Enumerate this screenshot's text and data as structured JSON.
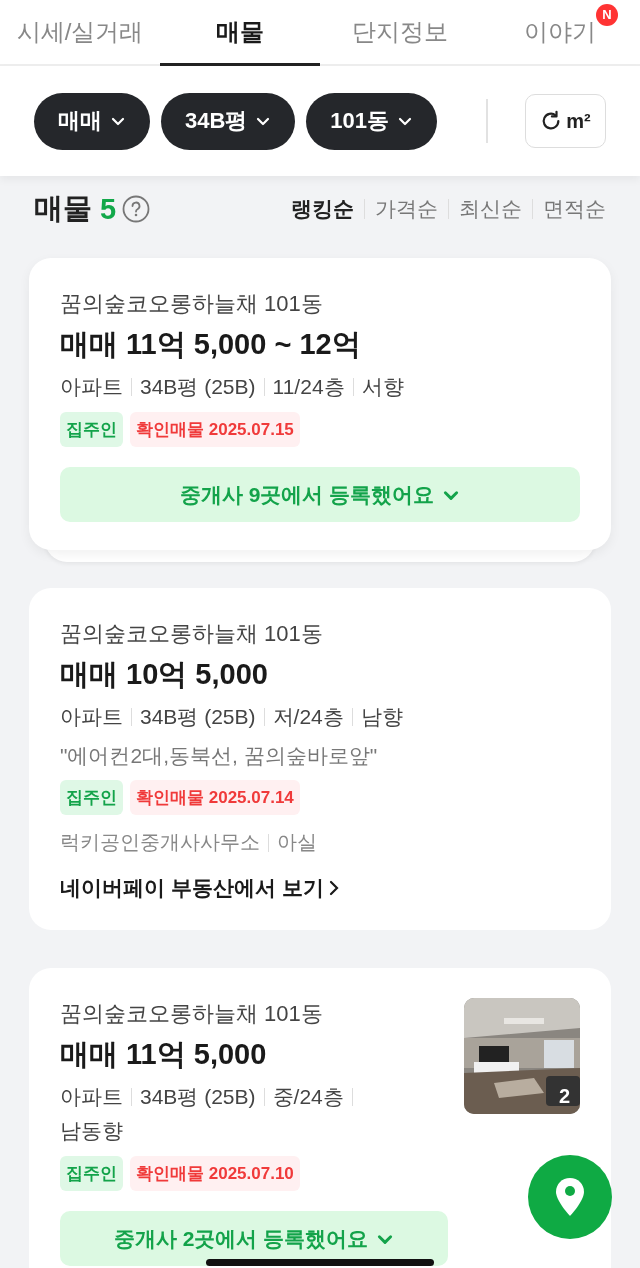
{
  "tabs": [
    {
      "label": "시세/실거래",
      "selected": false
    },
    {
      "label": "매물",
      "selected": true
    },
    {
      "label": "단지정보",
      "selected": false
    },
    {
      "label": "이야기",
      "selected": false,
      "badge": "N"
    }
  ],
  "filters": [
    {
      "label": "매매"
    },
    {
      "label": "34B평"
    },
    {
      "label": "101동"
    }
  ],
  "unit_button": {
    "label": "m²"
  },
  "listing_header": {
    "title": "매물",
    "count": "5"
  },
  "sort_options": [
    {
      "label": "랭킹순",
      "selected": true
    },
    {
      "label": "가격순",
      "selected": false
    },
    {
      "label": "최신순",
      "selected": false
    },
    {
      "label": "면적순",
      "selected": false
    }
  ],
  "listings": [
    {
      "name": "꿈의숲코오롱하늘채 101동",
      "price": "매매 11억 5,000 ~ 12억",
      "meta": [
        "아파트",
        "34B평 (25B)",
        "11/24층",
        "서향"
      ],
      "tags": [
        {
          "label": "집주인",
          "kind": "owner"
        },
        {
          "label": "확인매물 2025.07.15",
          "kind": "verified"
        }
      ],
      "brokers": "중개사 **9**곳에서 등록했어요",
      "stacked": true
    },
    {
      "name": "꿈의숲코오롱하늘채 101동",
      "price": "매매 10억 5,000",
      "meta": [
        "아파트",
        "34B평 (25B)",
        "저/24층",
        "남향"
      ],
      "description": "\"에어컨2대,동북선, 꿈의숲바로앞\"",
      "tags": [
        {
          "label": "집주인",
          "kind": "owner"
        },
        {
          "label": "확인매물 2025.07.14",
          "kind": "verified"
        }
      ],
      "agent": [
        "럭키공인중개사사무소",
        "아실"
      ],
      "link": "네이버페이 부동산에서 보기"
    },
    {
      "name": "꿈의숲코오롱하늘채 101동",
      "price": "매매 11억 5,000",
      "meta": [
        "아파트",
        "34B평 (25B)",
        "중/24층",
        "남동향"
      ],
      "photo": {
        "kind": "picture",
        "count": "2"
      },
      "tags": [
        {
          "label": "집주인",
          "kind": "owner"
        },
        {
          "label": "확인매물 2025.07.10",
          "kind": "verified"
        }
      ],
      "brokers": "중개사 **2**곳에서 등록했어요"
    }
  ]
}
